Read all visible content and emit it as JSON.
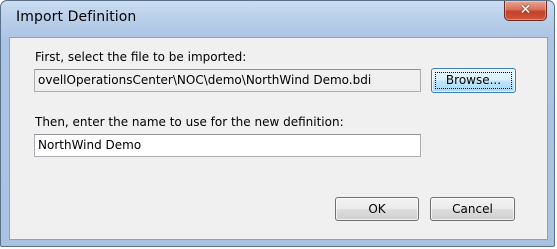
{
  "window": {
    "title": "Import Definition",
    "close_icon": "close-x-icon"
  },
  "file_section": {
    "prompt": "First, select the file to be imported:",
    "path_value": "ovellOperationsCenter\\NOC\\demo\\NorthWind Demo.bdi",
    "browse_label": "Browse..."
  },
  "name_section": {
    "prompt": "Then, enter the name to use for the new definition:",
    "name_value": "NorthWind Demo"
  },
  "buttons": {
    "ok_label": "OK",
    "cancel_label": "Cancel"
  }
}
